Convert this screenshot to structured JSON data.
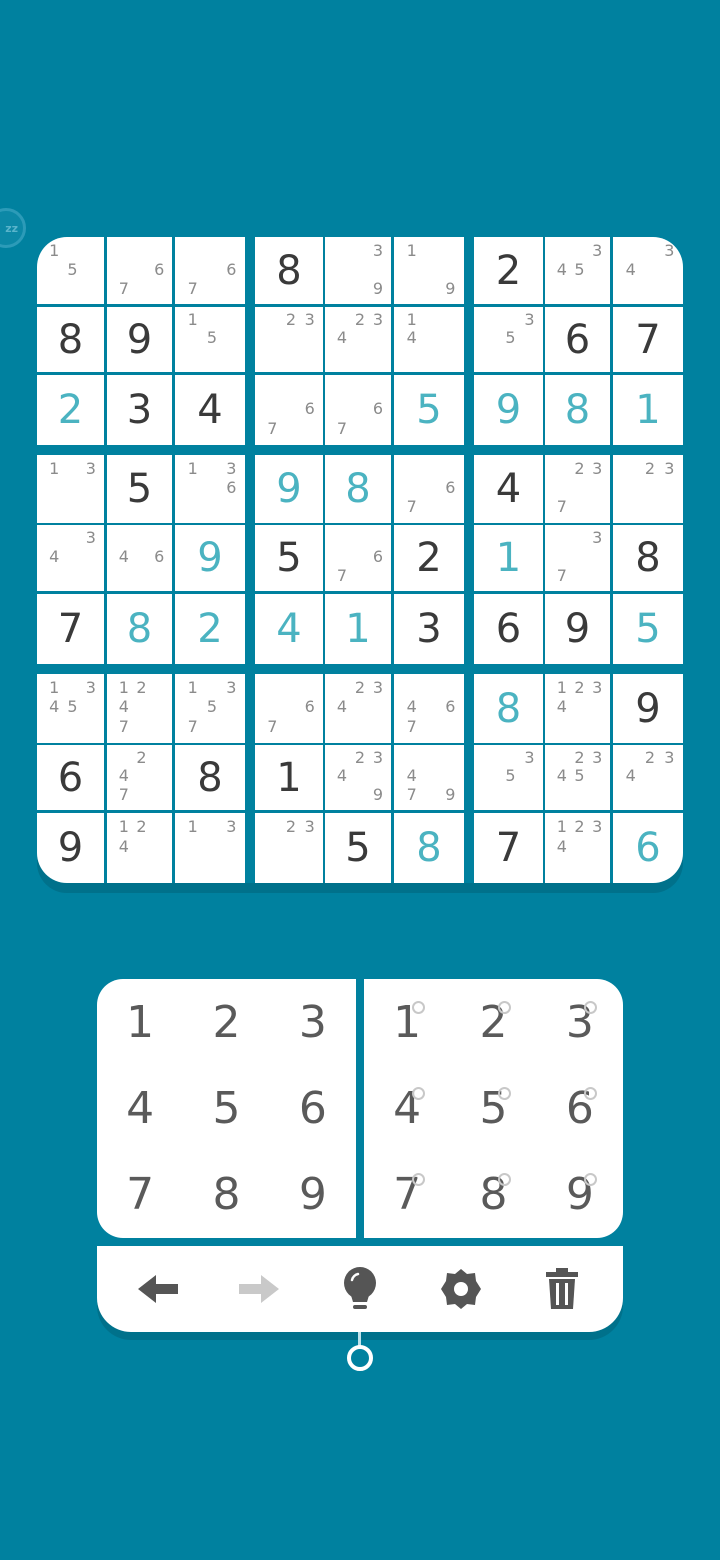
{
  "sleep_button": {
    "label": "zz"
  },
  "board": {
    "rows": [
      [
        {
          "v": "",
          "n": [
            1,
            5
          ]
        },
        {
          "v": "",
          "n": [
            6,
            7
          ]
        },
        {
          "v": "",
          "n": [
            6,
            7
          ]
        },
        {
          "v": "8",
          "t": "given"
        },
        {
          "v": "",
          "n": [
            3,
            9
          ]
        },
        {
          "v": "",
          "n": [
            1,
            9
          ]
        },
        {
          "v": "2",
          "t": "given"
        },
        {
          "v": "",
          "n": [
            3,
            4,
            5
          ]
        },
        {
          "v": "",
          "n": [
            3,
            4
          ]
        }
      ],
      [
        {
          "v": "8",
          "t": "given"
        },
        {
          "v": "9",
          "t": "given"
        },
        {
          "v": "",
          "n": [
            1,
            5
          ]
        },
        {
          "v": "",
          "n": [
            2,
            3
          ]
        },
        {
          "v": "",
          "n": [
            2,
            3,
            4
          ]
        },
        {
          "v": "",
          "n": [
            1,
            4
          ]
        },
        {
          "v": "",
          "n": [
            3,
            5
          ]
        },
        {
          "v": "6",
          "t": "given"
        },
        {
          "v": "7",
          "t": "given"
        }
      ],
      [
        {
          "v": "2",
          "t": "user"
        },
        {
          "v": "3",
          "t": "given"
        },
        {
          "v": "4",
          "t": "given"
        },
        {
          "v": "",
          "n": [
            6,
            7
          ]
        },
        {
          "v": "",
          "n": [
            6,
            7
          ]
        },
        {
          "v": "5",
          "t": "user"
        },
        {
          "v": "9",
          "t": "user"
        },
        {
          "v": "8",
          "t": "user"
        },
        {
          "v": "1",
          "t": "user"
        }
      ],
      [
        {
          "v": "",
          "n": [
            1,
            3
          ]
        },
        {
          "v": "5",
          "t": "given"
        },
        {
          "v": "",
          "n": [
            1,
            3,
            6
          ]
        },
        {
          "v": "9",
          "t": "user"
        },
        {
          "v": "8",
          "t": "user"
        },
        {
          "v": "",
          "n": [
            6,
            7
          ]
        },
        {
          "v": "4",
          "t": "given"
        },
        {
          "v": "",
          "n": [
            2,
            3,
            7
          ]
        },
        {
          "v": "",
          "n": [
            2,
            3
          ]
        }
      ],
      [
        {
          "v": "",
          "n": [
            3,
            4
          ]
        },
        {
          "v": "",
          "n": [
            4,
            6
          ]
        },
        {
          "v": "9",
          "t": "user"
        },
        {
          "v": "5",
          "t": "given"
        },
        {
          "v": "",
          "n": [
            6,
            7
          ]
        },
        {
          "v": "2",
          "t": "given"
        },
        {
          "v": "1",
          "t": "user"
        },
        {
          "v": "",
          "n": [
            3,
            7
          ]
        },
        {
          "v": "8",
          "t": "given"
        }
      ],
      [
        {
          "v": "7",
          "t": "given"
        },
        {
          "v": "8",
          "t": "user"
        },
        {
          "v": "2",
          "t": "user"
        },
        {
          "v": "4",
          "t": "user"
        },
        {
          "v": "1",
          "t": "user"
        },
        {
          "v": "3",
          "t": "given"
        },
        {
          "v": "6",
          "t": "given"
        },
        {
          "v": "9",
          "t": "given"
        },
        {
          "v": "5",
          "t": "user"
        }
      ],
      [
        {
          "v": "",
          "n": [
            1,
            3,
            4,
            5
          ]
        },
        {
          "v": "",
          "n": [
            1,
            2,
            4,
            7
          ]
        },
        {
          "v": "",
          "n": [
            1,
            3,
            5,
            7
          ]
        },
        {
          "v": "",
          "n": [
            6,
            7
          ]
        },
        {
          "v": "",
          "n": [
            2,
            3,
            4
          ]
        },
        {
          "v": "",
          "n": [
            4,
            6,
            7
          ]
        },
        {
          "v": "8",
          "t": "user"
        },
        {
          "v": "",
          "n": [
            1,
            2,
            3,
            4
          ]
        },
        {
          "v": "9",
          "t": "given"
        }
      ],
      [
        {
          "v": "6",
          "t": "given"
        },
        {
          "v": "",
          "n": [
            2,
            4,
            7
          ]
        },
        {
          "v": "8",
          "t": "given"
        },
        {
          "v": "1",
          "t": "given"
        },
        {
          "v": "",
          "n": [
            2,
            3,
            4,
            9
          ]
        },
        {
          "v": "",
          "n": [
            4,
            7,
            9
          ]
        },
        {
          "v": "",
          "n": [
            3,
            5
          ]
        },
        {
          "v": "",
          "n": [
            2,
            3,
            4,
            5
          ]
        },
        {
          "v": "",
          "n": [
            2,
            3,
            4
          ]
        }
      ],
      [
        {
          "v": "9",
          "t": "given"
        },
        {
          "v": "",
          "n": [
            1,
            2,
            4
          ]
        },
        {
          "v": "",
          "n": [
            1,
            3
          ]
        },
        {
          "v": "",
          "n": [
            2,
            3
          ]
        },
        {
          "v": "5",
          "t": "given"
        },
        {
          "v": "8",
          "t": "user"
        },
        {
          "v": "7",
          "t": "given"
        },
        {
          "v": "",
          "n": [
            1,
            2,
            3,
            4
          ]
        },
        {
          "v": "6",
          "t": "user"
        }
      ]
    ]
  },
  "keypad": {
    "digits": [
      "1",
      "2",
      "3",
      "4",
      "5",
      "6",
      "7",
      "8",
      "9"
    ]
  },
  "toolbar": {
    "icons": [
      "undo-arrow-icon",
      "redo-arrow-icon",
      "hint-bulb-icon",
      "settings-gear-icon",
      "trash-icon"
    ],
    "redo_enabled": false
  },
  "colors": {
    "background": "#00819F",
    "given_digit": "#3a3a3a",
    "user_digit": "#4bb3c1",
    "note_digit": "#8b8b8b"
  }
}
